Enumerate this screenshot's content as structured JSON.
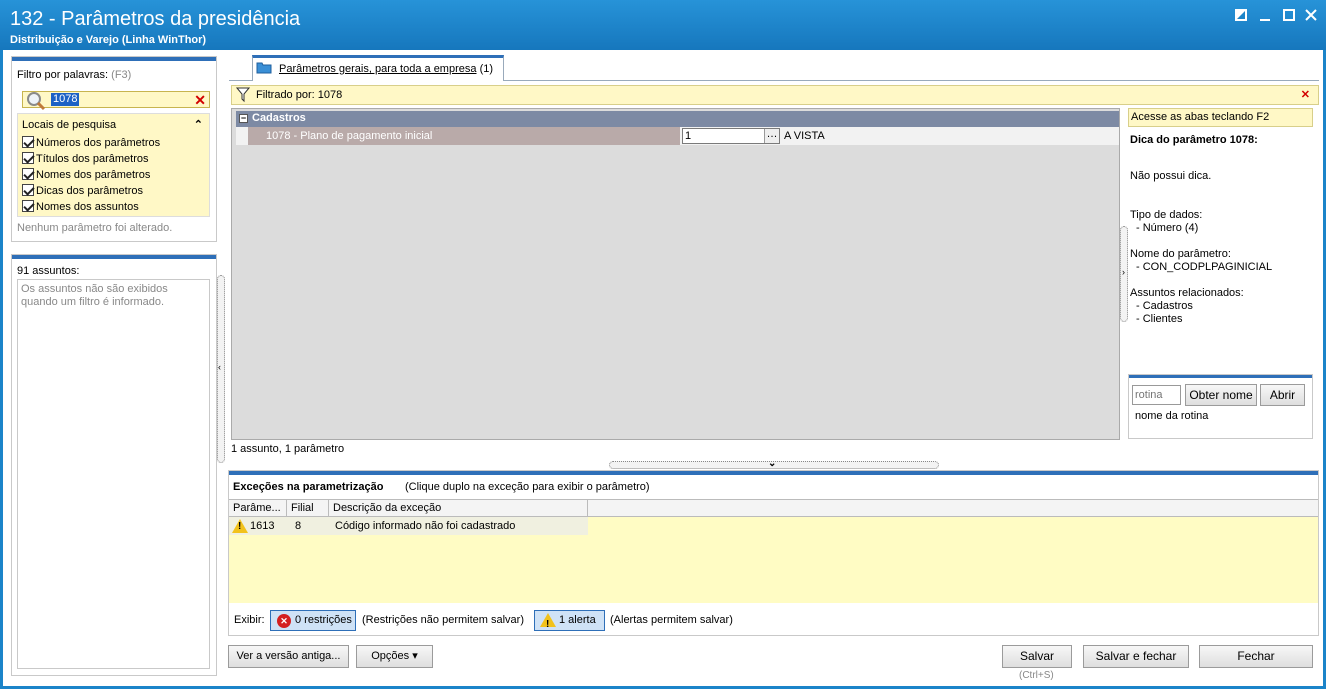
{
  "window": {
    "title": "132 - Parâmetros da presidência",
    "subtitle": "Distribuição e Varejo (Linha WinThor)",
    "controls": [
      "restore-icon",
      "minimize-icon",
      "maximize-icon",
      "close-icon"
    ]
  },
  "left": {
    "filter_label": "Filtro por palavras:",
    "filter_shortcut": "(F3)",
    "filter_value": "1078",
    "search_locations_title": "Locais de pesquisa",
    "locations": [
      {
        "label": "Números dos parâmetros",
        "checked": true
      },
      {
        "label": "Títulos dos parâmetros",
        "checked": true
      },
      {
        "label": "Nomes dos parâmetros",
        "checked": true
      },
      {
        "label": "Dicas dos parâmetros",
        "checked": true
      },
      {
        "label": "Nomes dos assuntos",
        "checked": true
      }
    ],
    "status_text": "Nenhum parâmetro foi alterado.",
    "subjects_title": "91 assuntos:",
    "subjects_note": "Os assuntos não são exibidos quando um filtro é informado."
  },
  "tabs": [
    {
      "label": "Parâmetros gerais, para toda a empresa",
      "count": "(1)"
    }
  ],
  "filter_bar": {
    "text": "Filtrado por: 1078"
  },
  "grid": {
    "group": "Cadastros",
    "rows": [
      {
        "name": "1078 - Plano de pagamento inicial",
        "value": "1",
        "description": "A VISTA"
      }
    ],
    "footer": "1 assunto, 1 parâmetro"
  },
  "hint": {
    "tabs_hint": "Acesse as abas teclando F2",
    "title": "Dica do parâmetro 1078:",
    "text": "Não possui dica.",
    "data_type_label": "Tipo de dados:",
    "data_type_value": "- Número (4)",
    "param_name_label": "Nome do parâmetro:",
    "param_name_value": "- CON_CODPLPAGINICIAL",
    "related_label": "Assuntos relacionados:",
    "related": [
      "- Cadastros",
      "- Clientes"
    ]
  },
  "rotina": {
    "placeholder": "rotina",
    "get_name_label": "Obter nome",
    "open_label": "Abrir",
    "name_label": "nome da rotina"
  },
  "exceptions": {
    "title": "Exceções na parametrização",
    "subtitle": "(Clique duplo na exceção para exibir o parâmetro)",
    "columns": [
      "Parâme...",
      "Filial",
      "Descrição da exceção"
    ],
    "rows": [
      {
        "param": "1613",
        "filial": "8",
        "description": "Código informado não foi cadastrado"
      }
    ],
    "show_label": "Exibir:",
    "restrictions_label": "0 restrições",
    "restrictions_note": "(Restrições não permitem salvar)",
    "alerts_label": "1 alerta",
    "alerts_note": "(Alertas permitem salvar)"
  },
  "footer": {
    "old_version_label": "Ver a versão antiga...",
    "options_label": "Opções",
    "save_label": "Salvar",
    "save_shortcut": "(Ctrl+S)",
    "save_close_label": "Salvar e fechar",
    "close_label": "Fechar"
  },
  "colors": {
    "titlebar": "#1b84c9",
    "highlight_yellow": "#fff8c6",
    "group_header": "#7d8aa4",
    "accent_blue": "#2e6fb8"
  }
}
